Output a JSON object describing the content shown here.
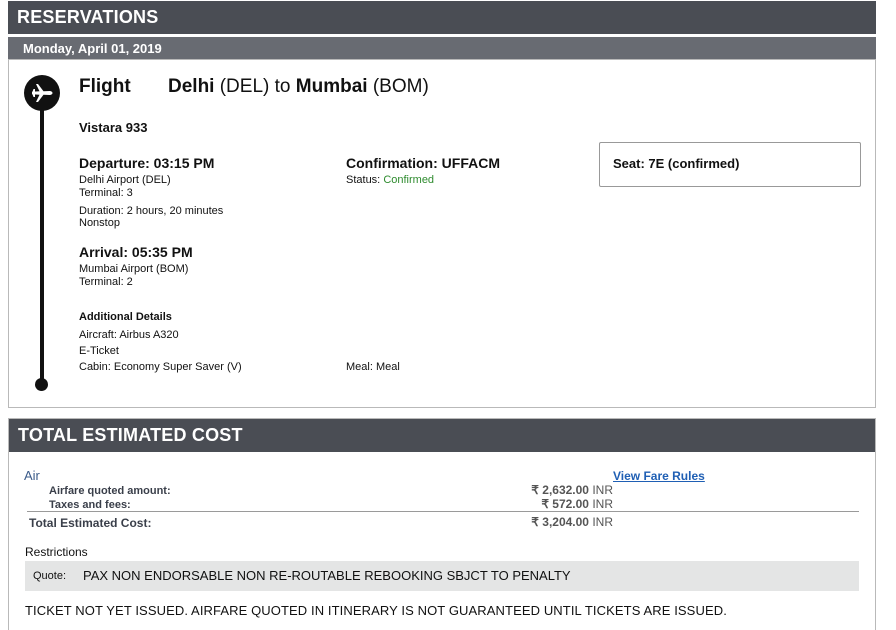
{
  "reservations": {
    "title": "RESERVATIONS",
    "date": "Monday, April 01, 2019"
  },
  "flight": {
    "label": "Flight",
    "from_city": "Delhi",
    "from_code": "(DEL)",
    "to_word": "to",
    "to_city": "Mumbai",
    "to_code": "(BOM)",
    "airline": "Vistara 933",
    "departure": {
      "heading": "Departure: 03:15 PM",
      "airport": "Delhi Airport (DEL)",
      "terminal": "Terminal: 3",
      "duration": "Duration: 2 hours, 20 minutes",
      "stops": "Nonstop"
    },
    "arrival": {
      "heading": "Arrival: 05:35 PM",
      "airport": "Mumbai Airport (BOM)",
      "terminal": "Terminal: 2"
    },
    "confirmation": {
      "heading": "Confirmation: UFFACM",
      "status_label": "Status:",
      "status_value": "Confirmed"
    },
    "seat": "Seat: 7E (confirmed)",
    "additional": {
      "heading": "Additional Details",
      "aircraft": "Aircraft: Airbus A320",
      "ticket": "E-Ticket",
      "cabin": "Cabin: Economy Super Saver (V)",
      "meal": "Meal: Meal"
    },
    "icon": "airplane-icon"
  },
  "cost": {
    "title": "TOTAL ESTIMATED COST",
    "section": "Air",
    "fare_rules_link": "View Fare Rules",
    "rows": [
      {
        "label": "Airfare quoted amount:",
        "amount": "₹ 2,632.00",
        "currency": "INR"
      },
      {
        "label": "Taxes and fees:",
        "amount": "₹ 572.00",
        "currency": "INR"
      }
    ],
    "total_label": "Total Estimated Cost:",
    "total_amount": "₹ 3,204.00",
    "total_currency": "INR",
    "restrictions_heading": "Restrictions",
    "quote_label": "Quote:",
    "quote_text": "PAX NON ENDORSABLE NON RE-ROUTABLE REBOOKING SBJCT TO PENALTY",
    "notice": "TICKET NOT YET ISSUED. AIRFARE QUOTED IN ITINERARY IS NOT GUARANTEED UNTIL TICKETS ARE ISSUED."
  },
  "colors": {
    "header_bg": "#4a4d54",
    "date_bar_bg": "#686b72",
    "status_green": "#2e8b2e",
    "link_blue": "#1f5fb4",
    "quote_bg": "#e4e5e5"
  }
}
